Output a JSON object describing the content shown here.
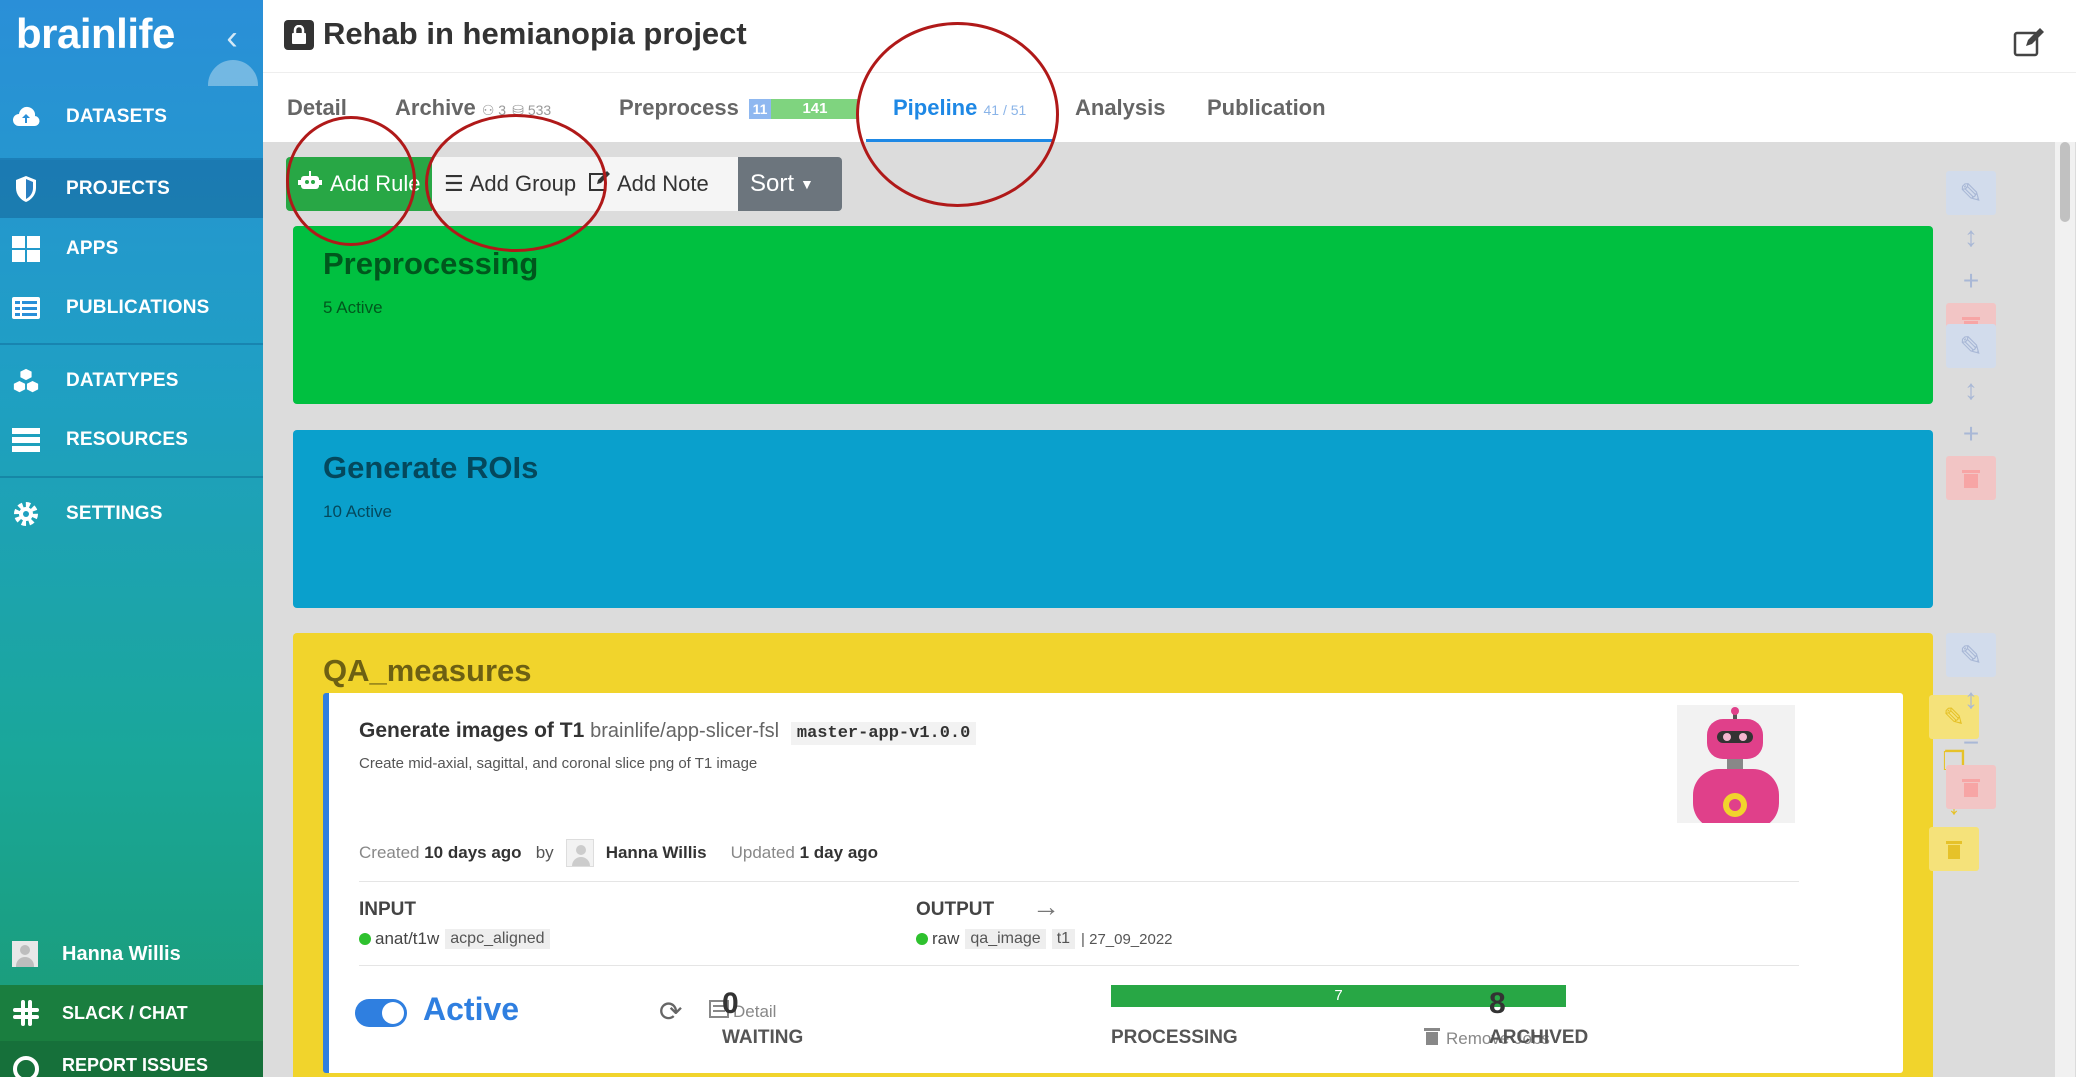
{
  "sidebar": {
    "logo": "brainlife",
    "items": [
      {
        "label": "DATASETS",
        "icon": "cloud-upload-icon"
      },
      {
        "label": "PROJECTS",
        "icon": "shield-icon"
      },
      {
        "label": "APPS",
        "icon": "grid-icon"
      },
      {
        "label": "PUBLICATIONS",
        "icon": "list-icon"
      },
      {
        "label": "DATATYPES",
        "icon": "cubes-icon"
      },
      {
        "label": "RESOURCES",
        "icon": "server-icon"
      },
      {
        "label": "SETTINGS",
        "icon": "gear-icon"
      }
    ],
    "user": "Hanna Willis",
    "slack": "SLACK / CHAT",
    "report": "REPORT ISSUES"
  },
  "header": {
    "title": "Rehab in hemianopia project"
  },
  "tabs": {
    "detail": "Detail",
    "archive": "Archive",
    "archive_users": "3",
    "archive_count": "533",
    "preprocess": "Preprocess",
    "preprocess_a": "11",
    "preprocess_b": "141",
    "pipeline": "Pipeline",
    "pipeline_count": "41 / 51",
    "analysis": "Analysis",
    "publication": "Publication"
  },
  "toolbar": {
    "add_rule": "Add Rule",
    "add_group": "Add Group",
    "add_note": "Add Note",
    "sort": "Sort"
  },
  "groups": [
    {
      "title": "Preprocessing",
      "sub": "5 Active",
      "color": "#00c040"
    },
    {
      "title": "Generate ROIs",
      "sub": "10 Active",
      "color": "#0aa0cc"
    },
    {
      "title": "QA_measures",
      "color": "#f1d42c"
    }
  ],
  "rule": {
    "name": "Generate images of T1",
    "repo": "brainlife/app-slicer-fsl",
    "branch": "master-app-v1.0.0",
    "desc": "Create mid-axial, sagittal, and coronal slice png of T1 image",
    "created_label": "Created",
    "created": "10 days ago",
    "by": "by",
    "user": "Hanna Willis",
    "updated_label": "Updated",
    "updated": "1 day ago",
    "input_label": "INPUT",
    "input_type": "anat/t1w",
    "input_tag": "acpc_aligned",
    "output_label": "OUTPUT",
    "output_type": "raw",
    "output_tag1": "qa_image",
    "output_tag2": "t1",
    "output_extra": "| 27_09_2022",
    "active": "Active",
    "detail": "Detail",
    "waiting_num": "0",
    "waiting": "WAITING",
    "processing_bar": "7",
    "processing": "PROCESSING",
    "remove_jobs": "Remove Jobs",
    "archived_num": "8",
    "archived": "ARCHIVED"
  }
}
